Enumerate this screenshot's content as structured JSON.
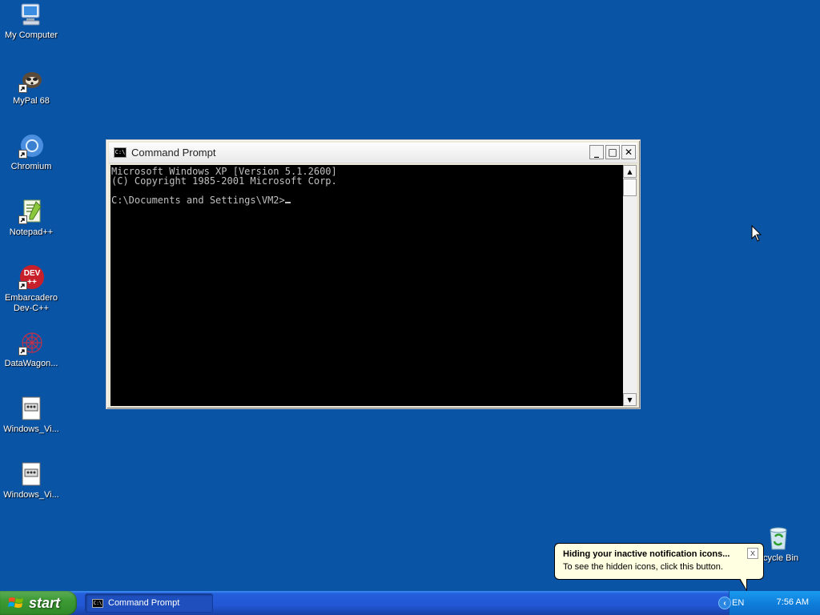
{
  "desktop": {
    "background_color": "#0a54a6",
    "icons": [
      {
        "label": "My Computer",
        "icon": "my-computer-icon"
      },
      {
        "label": "MyPal 68",
        "icon": "mypal-icon"
      },
      {
        "label": "Chromium",
        "icon": "chromium-icon"
      },
      {
        "label": "Notepad++",
        "icon": "notepadpp-icon"
      },
      {
        "label": "Embarcadero\nDev-C++",
        "icon": "devcpp-icon"
      },
      {
        "label": "DataWagon...",
        "icon": "datawagon-icon"
      },
      {
        "label": "Windows_Vi...",
        "icon": "document-icon"
      },
      {
        "label": "Windows_Vi...",
        "icon": "document-icon"
      }
    ],
    "recycle_bin": {
      "label": "ecycle Bin",
      "icon": "recycle-bin-icon"
    }
  },
  "window": {
    "title": "Command Prompt",
    "icon_text": "C:\\",
    "minimize": "_",
    "maximize": "□",
    "close": "✕",
    "console_lines": [
      "Microsoft Windows XP [Version 5.1.2600]",
      "(C) Copyright 1985-2001 Microsoft Corp.",
      "",
      "C:\\Documents and Settings\\VM2>"
    ],
    "scroll_up": "▲",
    "scroll_down": "▼"
  },
  "balloon": {
    "title": "Hiding your inactive notification icons...",
    "body": "To see the hidden icons, click this button.",
    "close": "x"
  },
  "taskbar": {
    "start_label": "start",
    "task_label": "Command Prompt",
    "task_icon_text": "C:\\",
    "language": "EN",
    "clock": "7:56 AM",
    "expand_glyph": "‹"
  }
}
